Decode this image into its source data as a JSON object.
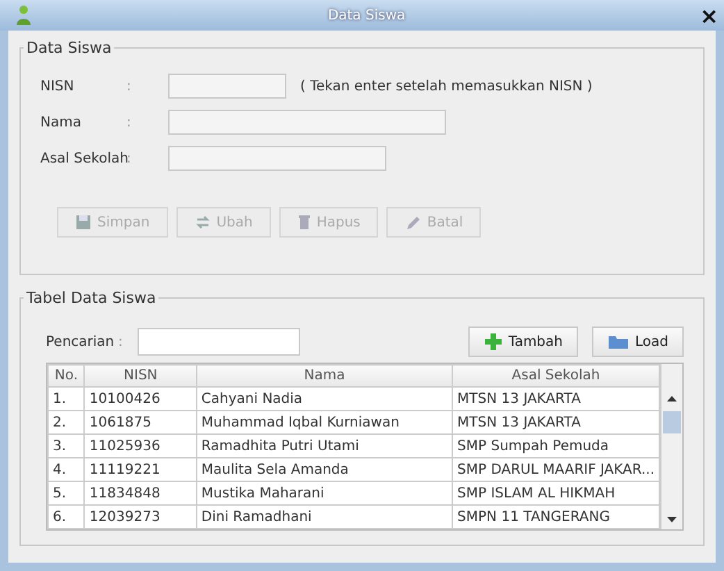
{
  "window": {
    "title": "Data Siswa",
    "close": "×"
  },
  "form": {
    "legend": "Data Siswa",
    "fields": [
      {
        "label": "NISN",
        "colon": ":",
        "hint_text": "( Tekan enter setelah memasukkan NISN )"
      },
      {
        "label": "Nama",
        "colon": ":"
      },
      {
        "label": "Asal Sekolah",
        "colon": ":"
      }
    ],
    "buttons": [
      {
        "label": "Simpan",
        "disabled": true
      },
      {
        "label": "Ubah",
        "disabled": true
      },
      {
        "label": "Hapus",
        "disabled": true
      },
      {
        "label": "Batal",
        "disabled": true
      }
    ]
  },
  "table_section": {
    "legend": "Tabel Data Siswa",
    "search_label": "Pencarian",
    "search_colon": ":",
    "buttons": [
      {
        "label": "Tambah"
      },
      {
        "label": "Load"
      }
    ],
    "table": {
      "columns": [
        "No.",
        "NISN",
        "Nama",
        "Asal Sekolah"
      ],
      "rows": [
        [
          "1.",
          "10100426",
          "Cahyani Nadia",
          "MTSN 13 JAKARTA"
        ],
        [
          "2.",
          "1061875",
          "Muhammad Iqbal Kurniawan",
          "MTSN 13 JAKARTA"
        ],
        [
          "3.",
          "11025936",
          "Ramadhita Putri Utami",
          "SMP Sumpah Pemuda"
        ],
        [
          "4.",
          "11119221",
          "Maulita Sela Amanda",
          "SMP DARUL MAARIF JAKAR..."
        ],
        [
          "5.",
          "11834848",
          "Mustika Maharani",
          "SMP ISLAM AL HIKMAH"
        ],
        [
          "6.",
          "12039273",
          "Dini Ramadhani",
          "SMPN 11 TANGERANG"
        ]
      ]
    }
  }
}
